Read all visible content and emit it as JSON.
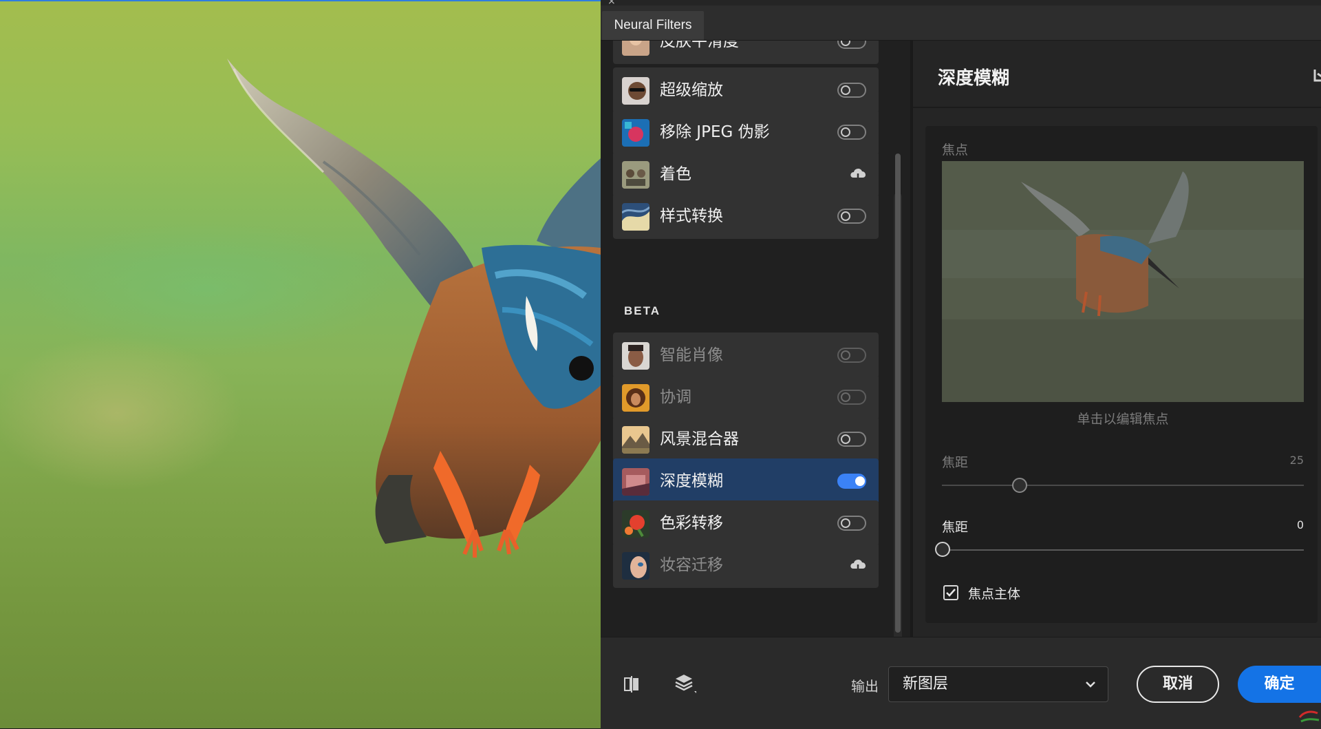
{
  "tab": {
    "title": "Neural Filters"
  },
  "filters": {
    "items": [
      {
        "name": "filter-skin-smoothing",
        "label": "皮肤平滑度",
        "control": "toggle",
        "on": false,
        "dim": false
      },
      {
        "name": "filter-super-zoom",
        "label": "超级缩放",
        "control": "toggle",
        "on": false,
        "dim": false
      },
      {
        "name": "filter-remove-jpeg",
        "label": "移除 JPEG 伪影",
        "control": "toggle",
        "on": false,
        "dim": false
      },
      {
        "name": "filter-colorize",
        "label": "着色",
        "control": "cloud-download",
        "on": false,
        "dim": false
      },
      {
        "name": "filter-style-transfer",
        "label": "样式转换",
        "control": "toggle",
        "on": false,
        "dim": false
      }
    ],
    "beta_heading": "BETA",
    "beta_items": [
      {
        "name": "filter-smart-portrait",
        "label": "智能肖像",
        "control": "toggle",
        "on": false,
        "dim": true
      },
      {
        "name": "filter-harmonization",
        "label": "协调",
        "control": "toggle",
        "on": false,
        "dim": true
      },
      {
        "name": "filter-landscape-mixer",
        "label": "风景混合器",
        "control": "toggle",
        "on": false,
        "dim": false
      },
      {
        "name": "filter-depth-blur",
        "label": "深度模糊",
        "control": "toggle",
        "on": true,
        "dim": false,
        "active": true
      },
      {
        "name": "filter-color-transfer",
        "label": "色彩转移",
        "control": "toggle",
        "on": false,
        "dim": false
      },
      {
        "name": "filter-makeup-transfer",
        "label": "妆容迁移",
        "control": "cloud-download",
        "on": false,
        "dim": true
      }
    ]
  },
  "settings": {
    "title": "深度模糊",
    "focal_point_label": "焦点",
    "preview_caption": "单击以编辑焦点",
    "slider1": {
      "label": "焦距",
      "value": "25"
    },
    "slider2": {
      "label": "焦距",
      "value": "0"
    },
    "checkbox": {
      "label": "焦点主体",
      "checked": true
    }
  },
  "footer": {
    "output_label": "输出",
    "output_value": "新图层",
    "cancel_label": "取消",
    "ok_label": "确定"
  },
  "colors": {
    "accent": "#1473e6",
    "active_item": "#213e66",
    "toggle_on": "#3b82f6"
  }
}
